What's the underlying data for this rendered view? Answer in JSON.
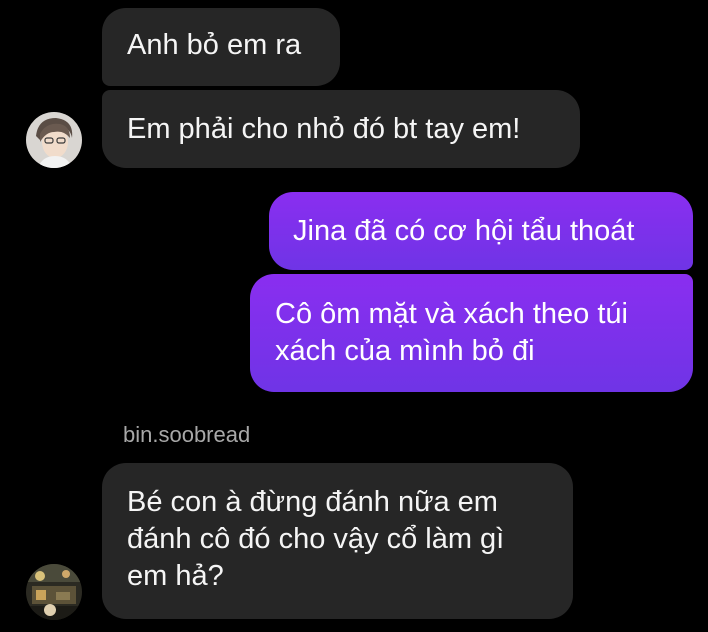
{
  "messages": [
    {
      "side": "incoming",
      "lines": [
        "Anh bỏ em ra"
      ]
    },
    {
      "side": "incoming",
      "lines": [
        "Em phải cho nhỏ đó bt tay em!"
      ]
    },
    {
      "side": "outgoing",
      "lines": [
        "Jina đã có cơ hội tẩu thoát"
      ]
    },
    {
      "side": "outgoing",
      "lines": [
        "Cô ôm mặt và xách theo túi",
        "xách của mình bỏ đi"
      ]
    },
    {
      "side": "incoming",
      "sender": "bin.soobread",
      "lines": [
        "Bé con à đừng đánh nữa em",
        "đánh cô đó cho vậy cổ làm gì",
        "em hả?"
      ]
    }
  ],
  "colors": {
    "background": "#000000",
    "incoming_bubble": "#262626",
    "outgoing_bubble_top": "#8a2ef0",
    "outgoing_bubble_bottom": "#6f34e6",
    "sender_name": "#a8a8a8"
  }
}
